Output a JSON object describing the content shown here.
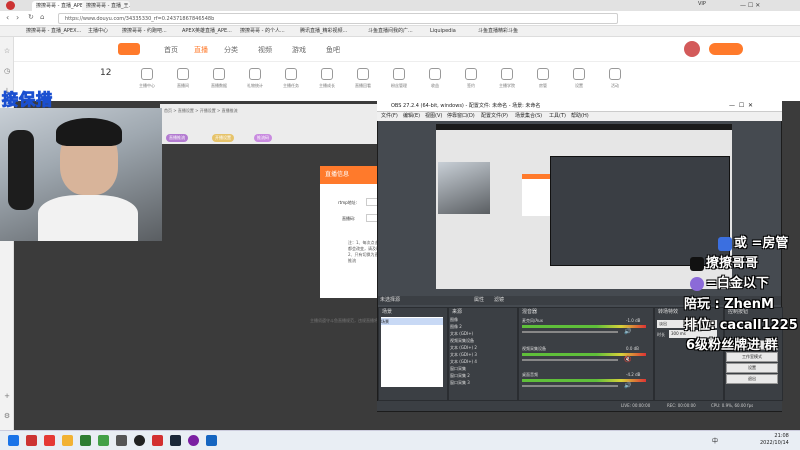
{
  "browser": {
    "tabs": [
      {
        "label": "撩撩哥哥 - 直播_APEX..."
      },
      {
        "label": "撩撩哥哥 - 直播_王..."
      },
      {
        "label": "主播中心"
      },
      {
        "label": "撩撩哥哥 - 约跑吧..."
      },
      {
        "label": "APEX英雄直播_APE..."
      },
      {
        "label": "撩撩哥哥 - 的个人..."
      },
      {
        "label": "腾讯直播_精彩视频..."
      },
      {
        "label": "斗鱼直播间我的广..."
      },
      {
        "label": "Liquipedia"
      },
      {
        "label": "斗鱼直播精彩斗鱼"
      }
    ],
    "url": "https://www.douyu.com/34335330_rf=0.24371867846548b",
    "bookmark": "斗鱼直播",
    "vip": "VIP"
  },
  "site": {
    "nav": [
      "首页",
      "直播",
      "分类",
      "视频",
      "游戏",
      "鱼吧"
    ],
    "follow_count": "12",
    "subnav": [
      "主播中心",
      "直播间",
      "直播数据",
      "礼物统计",
      "主播任务",
      "主播成长",
      "直播回看",
      "粉丝管理",
      "收益",
      "签约",
      "主播学院",
      "房管",
      "设置",
      "活动"
    ],
    "breadcrumb": "首页 > 直播设置 > 开播设置 > 直播推流",
    "tags": [
      "直播推流",
      "开播设置",
      "推流码",
      "开播提醒"
    ],
    "modal_title": "直播信息",
    "modal_label_rtmp": "rtmp地址:",
    "modal_label_code": "直播码:",
    "modal_note": "注：1、每次点击开播后推流码都会改变，请及时更新推流设置 2、只有切换为直播模式后才能推流",
    "footer_note": "主播须遵守斗鱼直播规范，违规直播将被封禁"
  },
  "stream_overlay": {
    "title": "接保措",
    "room_admin": "或    =房管",
    "douyin": "撩撩哥哥",
    "below_gold": "=白金以下",
    "companion": "陪玩   : ZhenM",
    "rank": "排位: cacall1225",
    "fan_badge": "6级粉丝牌进   群"
  },
  "obs": {
    "title": "OBS 27.2.4 (64-bit, windows) - 配置文件: 未命名 - 场景: 未命名",
    "menu": [
      "文件(F)",
      "编辑(E)",
      "视图(V)",
      "停靠窗口(D)",
      "配置文件(P)",
      "场景集合(S)",
      "工具(T)",
      "帮助(H)"
    ],
    "no_source": "未选择源",
    "props_btn": "属性",
    "filters_btn": "滤镜",
    "docks": {
      "scenes": "场景",
      "sources": "来源",
      "mixer": "混音器",
      "transitions": "转场特效",
      "controls": "控制按钮"
    },
    "scene_item": "场景",
    "sources": [
      "图像",
      "图像 2",
      "文本 (GDI+)",
      "视频采集设备",
      "文本 (GDI+) 2",
      "文本 (GDI+) 3",
      "文本 (GDI+) 4",
      "窗口采集",
      "窗口采集 2",
      "窗口采集 3"
    ],
    "mixer": [
      {
        "name": "麦克风/Aux",
        "db": "-1.0 dB"
      },
      {
        "name": "视频采集设备",
        "db": "0.0 dB"
      },
      {
        "name": "桌面音频",
        "db": "-4.2 dB"
      }
    ],
    "transition": "淡出",
    "duration_label": "时长",
    "duration": "300 ms",
    "controls": [
      "开始推流",
      "工作室模式",
      "设置",
      "退出"
    ],
    "status": {
      "live": "LIVE: 00:00:00",
      "rec": "REC: 00:00:00",
      "cpu": "CPU: 0.9%, 60.00 fps"
    }
  },
  "taskbar": {
    "time": "21:08",
    "date": "2022/10/14",
    "lang": "中"
  },
  "colors": {
    "douyu_orange": "#ff7a2b",
    "overlay_stroke": "#1a4fd0"
  }
}
